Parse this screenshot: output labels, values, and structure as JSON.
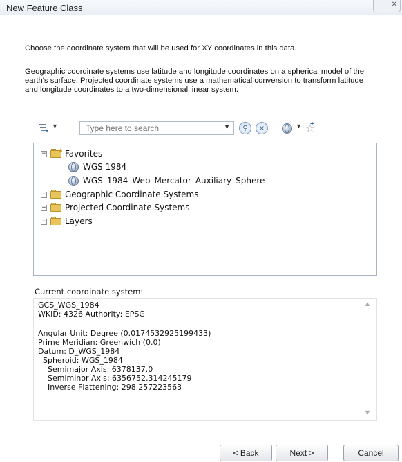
{
  "window": {
    "title": "New Feature Class",
    "close_glyph": "✕"
  },
  "intro": {
    "line1": "Choose the coordinate system that will be used for XY coordinates in this data.",
    "line2": "Geographic coordinate systems use latitude and longitude coordinates on a spherical model of the earth's surface. Projected coordinate systems use a mathematical conversion to transform latitude and longitude coordinates to a two-dimensional linear system."
  },
  "toolbar": {
    "filter_icon": "filter-icon",
    "search_placeholder": "Type here to search",
    "search_icon": "search-icon",
    "clear_icon": "clear-search-icon",
    "globe_icon": "globe-add-icon",
    "favorite_icon": "add-favorite-icon"
  },
  "tree": {
    "nodes": [
      {
        "label": "Favorites",
        "expander": "−",
        "icon": "favorites-folder-icon"
      },
      {
        "label": "WGS 1984",
        "icon": "globe-icon"
      },
      {
        "label": "WGS_1984_Web_Mercator_Auxiliary_Sphere",
        "icon": "globe-icon"
      },
      {
        "label": "Geographic Coordinate Systems",
        "expander": "+",
        "icon": "folder-icon"
      },
      {
        "label": "Projected Coordinate Systems",
        "expander": "+",
        "icon": "folder-icon"
      },
      {
        "label": "Layers",
        "expander": "+",
        "icon": "folder-icon"
      }
    ]
  },
  "current": {
    "label": "Current coordinate system:",
    "lines": [
      "GCS_WGS_1984",
      "WKID: 4326 Authority: EPSG",
      "",
      "Angular Unit: Degree (0.0174532925199433)",
      "Prime Meridian: Greenwich (0.0)",
      "Datum: D_WGS_1984",
      "  Spheroid: WGS_1984",
      "    Semimajor Axis: 6378137.0",
      "    Semiminor Axis: 6356752.314245179",
      "    Inverse Flattening: 298.257223563"
    ]
  },
  "footer": {
    "back": "< Back",
    "next": "Next >",
    "cancel": "Cancel"
  }
}
